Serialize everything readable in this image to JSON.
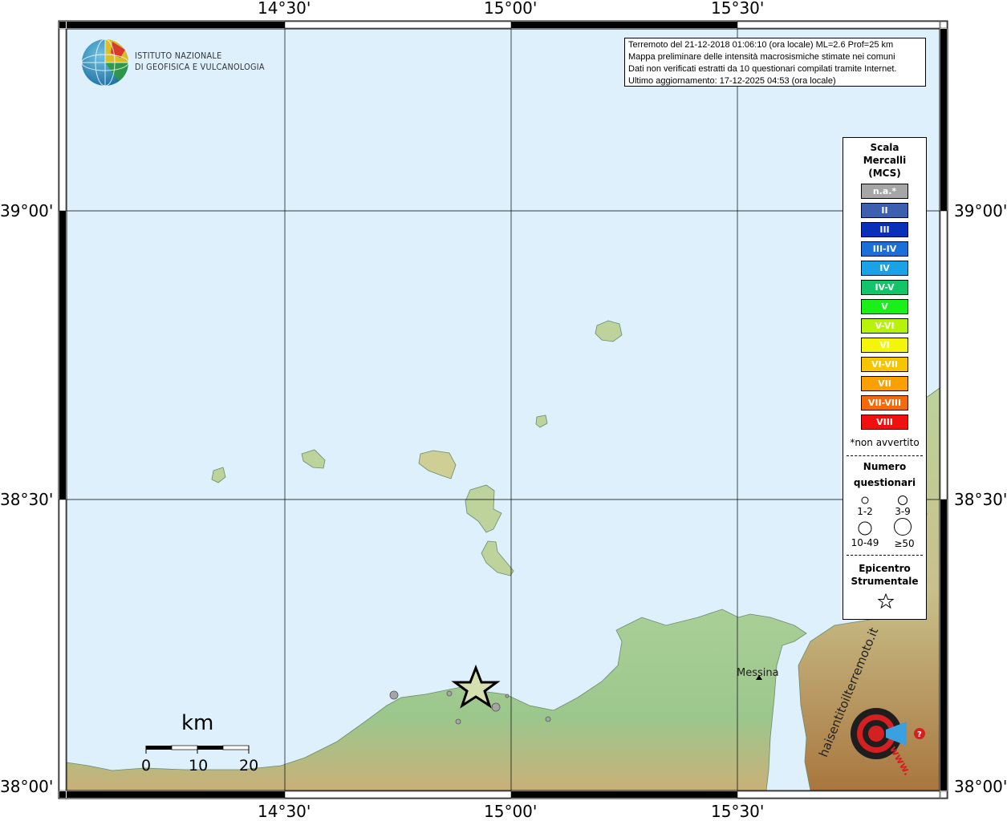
{
  "map": {
    "lon_labels": [
      "14°30'",
      "15°00'",
      "15°30'"
    ],
    "lat_labels": [
      "39°00'",
      "38°30'",
      "38°00'"
    ],
    "cities": [
      {
        "name": "Messina"
      }
    ]
  },
  "institute": {
    "name_line1": "ISTITUTO NAZIONALE",
    "name_line2": "DI GEOFISICA E VULCANOLOGIA"
  },
  "info": {
    "line1": "Terremoto del 21-12-2018 01:06:10 (ora locale) ML=2.6 Prof=25 km",
    "line2": "Mappa preliminare delle intensità macrosismiche stimate nei comuni",
    "line3": "Dati non verificati estratti da 10 questionari compilati tramite Internet.",
    "line4": "Ultimo aggiornamento: 17-12-2025 04:53 (ora locale)"
  },
  "legend": {
    "title_line1": "Scala",
    "title_line2": "Mercalli",
    "title_line3": "(MCS)",
    "intensities": [
      {
        "label": "n.a.*",
        "color": "#a6a6a6"
      },
      {
        "label": "II",
        "color": "#3d5fb0"
      },
      {
        "label": "III",
        "color": "#0a2fb8"
      },
      {
        "label": "III-IV",
        "color": "#1c6fd6"
      },
      {
        "label": "IV",
        "color": "#1aa2e6"
      },
      {
        "label": "IV-V",
        "color": "#13c46b"
      },
      {
        "label": "V",
        "color": "#19f019"
      },
      {
        "label": "V-VI",
        "color": "#b8f20a"
      },
      {
        "label": "VI",
        "color": "#f5f50a"
      },
      {
        "label": "VI-VII",
        "color": "#f7c400"
      },
      {
        "label": "VII",
        "color": "#f7a000"
      },
      {
        "label": "VII-VIII",
        "color": "#f26a0a"
      },
      {
        "label": "VIII",
        "color": "#f01010"
      }
    ],
    "footnote": "*non avvertito",
    "questionnaires_title_line1": "Numero",
    "questionnaires_title_line2": "questionari",
    "sizes": [
      "1-2",
      "3-9",
      "10-49",
      "≥50"
    ],
    "epicenter_line1": "Epicentro",
    "epicenter_line2": "Strumentale"
  },
  "scale_bar": {
    "unit": "km",
    "labels": [
      "0",
      "10",
      "20"
    ]
  },
  "watermark": {
    "text": "haisentitoilterremoto.it",
    "url": "www."
  },
  "colors": {
    "sea": "#ddf0fb",
    "land_low": "#8fc489",
    "land_mid": "#d7d29a",
    "land_high": "#b98a55",
    "frame": "#000000"
  }
}
